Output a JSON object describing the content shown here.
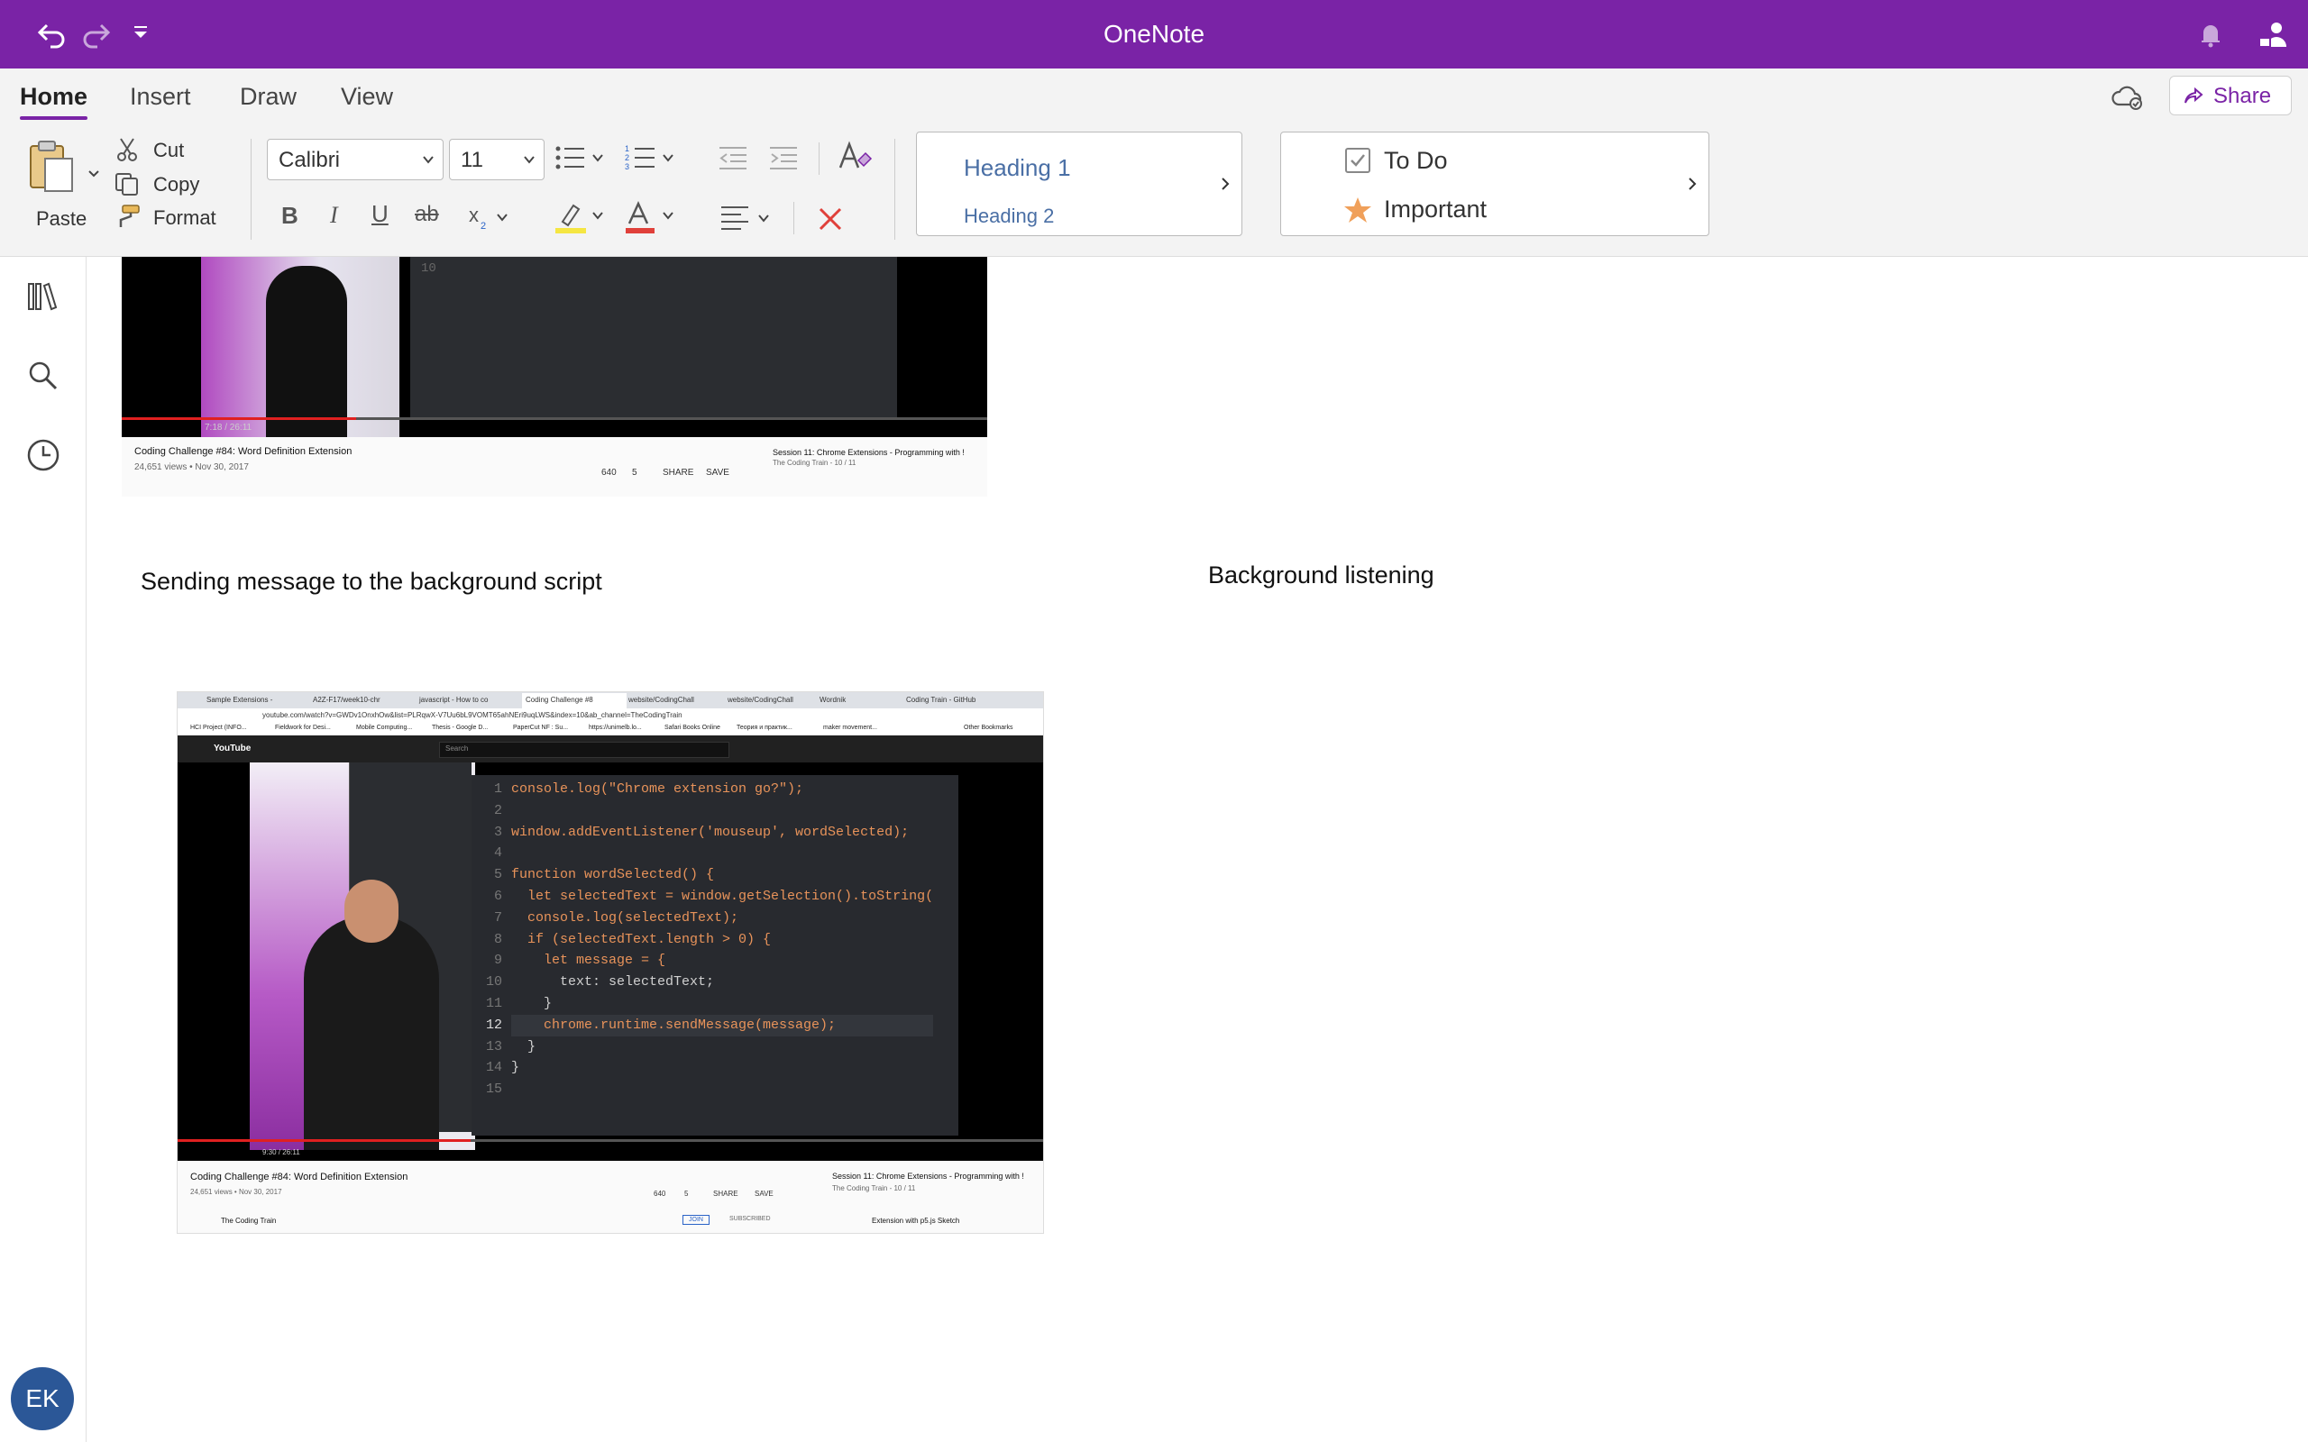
{
  "app": {
    "title": "OneNote"
  },
  "tabs": [
    {
      "label": "Home",
      "active": true
    },
    {
      "label": "Insert",
      "active": false
    },
    {
      "label": "Draw",
      "active": false
    },
    {
      "label": "View",
      "active": false
    }
  ],
  "share": {
    "label": "Share"
  },
  "clipboard": {
    "paste": "Paste",
    "cut": "Cut",
    "copy": "Copy",
    "format": "Format"
  },
  "font": {
    "family": "Calibri",
    "size": "11"
  },
  "styles": {
    "heading1": "Heading 1",
    "heading2": "Heading 2"
  },
  "tags": {
    "todo": "To Do",
    "important": "Important"
  },
  "avatar": {
    "initials": "EK"
  },
  "page": {
    "text_left": "Sending message to the background script",
    "text_right": "Background listening"
  },
  "video_top": {
    "title": "Coding Challenge #84: Word Definition Extension",
    "meta": "24,651 views • Nov 30, 2017",
    "likes": "640",
    "dislikes": "5",
    "share": "SHARE",
    "save": "SAVE",
    "session_title": "Session 11: Chrome Extensions - Programming with !",
    "session_sub": "The Coding Train - 10 / 11",
    "time": "7:18 / 26:11",
    "line_num": "10"
  },
  "video_main": {
    "tabs": [
      "Sample Extensions -",
      "A2Z-F17/week10-chr",
      "javascript - How to co",
      "Coding Challenge #8",
      "website/CodingChall",
      "website/CodingChall",
      "Wordnik",
      "Coding Train - GitHub"
    ],
    "url": "youtube.com/watch?v=GWDv1OnxhOw&list=PLRqwX-V7Uu6bL9VOMT65ahNEri9uqLWS&index=10&ab_channel=TheCodingTrain",
    "bookmarks": [
      "HCI Project (INFO...",
      "Fieldwork for Desi...",
      "Mobile Computing...",
      "Thesis - Google D...",
      "PaperCut NF : Su...",
      "https://unimelb.lo...",
      "Safari Books Online",
      "Теория и практик...",
      "maker movement..."
    ],
    "other_bookmarks": "Other Bookmarks",
    "search_placeholder": "Search",
    "youtube": "YouTube",
    "title": "Coding Challenge #84: Word Definition Extension",
    "meta": "24,651 views • Nov 30, 2017",
    "likes": "640",
    "dislikes": "5",
    "share": "SHARE",
    "save": "SAVE",
    "channel": "The Coding Train",
    "join": "JOIN",
    "subscribed": "SUBSCRIBED",
    "session_title": "Session 11: Chrome Extensions - Programming with !",
    "session_sub": "The Coding Train - 10 / 11",
    "next_video": "Extension with p5.js Sketch",
    "time": "9:30 / 26:11",
    "code_lines": [
      "console.log(\"Chrome extension go?\");",
      "",
      "window.addEventListener('mouseup', wordSelected);",
      "",
      "function wordSelected() {",
      "  let selectedText = window.getSelection().toString(",
      "  console.log(selectedText);",
      "  if (selectedText.length > 0) {",
      "    let message = {",
      "      text: selectedText;",
      "    }",
      "    chrome.runtime.sendMessage(message);",
      "  }",
      "}",
      ""
    ]
  },
  "colors": {
    "accent": "#7a23a6",
    "highlight": "#f5e642",
    "font_color": "#e0403a"
  }
}
